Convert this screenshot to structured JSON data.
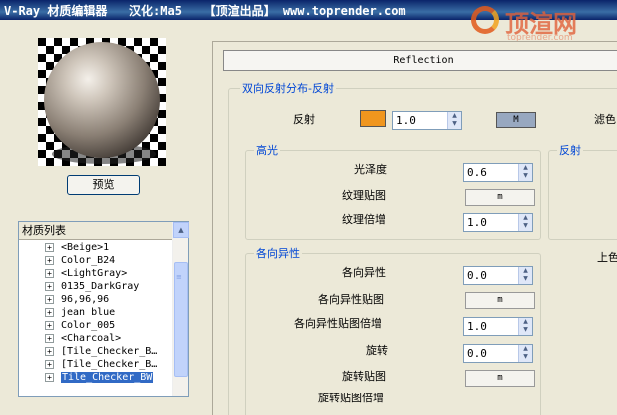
{
  "titlebar": {
    "text": "V-Ray 材质编辑器   汉化:Ma5   【顶渲出品】 www.toprender.com"
  },
  "watermark": {
    "brand": "顶渲网",
    "url": "toprender.com"
  },
  "preview": {
    "button_label": "预览"
  },
  "material_list": {
    "header": "材质列表",
    "items": [
      {
        "label": "<Beige>1",
        "expand": "+"
      },
      {
        "label": "Color_B24",
        "expand": "+"
      },
      {
        "label": "<LightGray>",
        "expand": "+"
      },
      {
        "label": "0135_DarkGray",
        "expand": "+"
      },
      {
        "label": "96,96,96",
        "expand": "+"
      },
      {
        "label": "jean blue",
        "expand": "+"
      },
      {
        "label": "Color_005",
        "expand": "+"
      },
      {
        "label": "<Charcoal>",
        "expand": "+"
      },
      {
        "label": "[Tile_Checker_B…",
        "expand": "+"
      },
      {
        "label": "[Tile_Checker_B…",
        "expand": "+"
      },
      {
        "label": "Tile_Checker_BW",
        "expand": "+",
        "selected": true
      }
    ]
  },
  "rollout": {
    "title_button": "Reflection",
    "brdf_group": {
      "title": "双向反射分布-反射",
      "reflection_label": "反射",
      "reflection_color": "#f0961e",
      "reflection_value": "1.0",
      "m_button": "M",
      "filter_label": "滤色"
    },
    "highlight_group": {
      "title": "高光",
      "glossiness_label": "光泽度",
      "glossiness_value": "0.6",
      "texmap_label": "纹理贴图",
      "texmap_button": "m",
      "texmult_label": "纹理倍增",
      "texmult_value": "1.0"
    },
    "reflect_group": {
      "title": "反射",
      "upper_label": "上色"
    },
    "anisotropy_group": {
      "title": "各向异性",
      "aniso_label": "各向异性",
      "aniso_value": "0.0",
      "aniso_map_label": "各向异性贴图",
      "aniso_map_button": "m",
      "aniso_mult_label": "各向异性贴图倍增",
      "aniso_mult_value": "1.0",
      "rotation_label": "旋转",
      "rotation_value": "0.0",
      "rotation_map_label": "旋转贴图",
      "rotation_map_button": "m",
      "rotation_mult_label": "旋转贴图倍增"
    }
  }
}
